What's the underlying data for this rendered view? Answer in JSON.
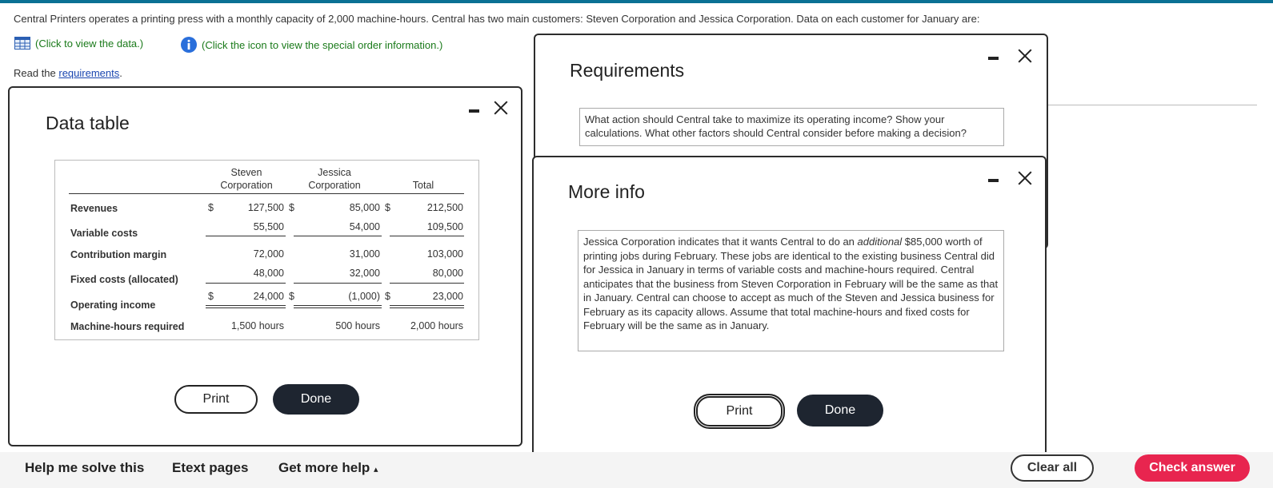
{
  "intro_text": "Central Printers operates a printing press with a monthly capacity of 2,000 machine-hours. Central has two main customers: Steven Corporation and Jessica Corporation. Data on each customer for January are:",
  "view_data_link": "(Click to view the data.)",
  "view_info_link": "(Click the icon to view the special order information.)",
  "read_prefix": "Read the ",
  "requirements_link": "requirements",
  "read_suffix": ".",
  "data_dialog": {
    "title": "Data table",
    "table": {
      "headers": {
        "steven": "Steven\nCorporation",
        "jessica": "Jessica\nCorporation",
        "total": "Total"
      },
      "rows": {
        "revenues": {
          "label": "Revenues",
          "steven": "127,500",
          "jessica": "85,000",
          "total": "212,500"
        },
        "variable_costs": {
          "label": "Variable costs",
          "steven": "55,500",
          "jessica": "54,000",
          "total": "109,500"
        },
        "contribution_margin": {
          "label": "Contribution margin",
          "steven": "72,000",
          "jessica": "31,000",
          "total": "103,000"
        },
        "fixed_costs": {
          "label": "Fixed costs (allocated)",
          "steven": "48,000",
          "jessica": "32,000",
          "total": "80,000"
        },
        "operating_income": {
          "label": "Operating income",
          "steven": "24,000",
          "jessica": "(1,000)",
          "total": "23,000"
        },
        "machine_hours": {
          "label": "Machine-hours required",
          "steven": "1,500 hours",
          "jessica": "500 hours",
          "total": "2,000 hours"
        }
      },
      "currency_symbol": "$"
    },
    "print_label": "Print",
    "done_label": "Done"
  },
  "requirements_dialog": {
    "title": "Requirements",
    "text": "What action should Central take to maximize its operating income? Show your calculations. What other factors should Central consider before making a decision?"
  },
  "more_info_dialog": {
    "title": "More info",
    "text_before": "Jessica Corporation indicates that it wants Central to do an ",
    "text_emphasis": "additional",
    "text_after": " $85,000 worth of printing jobs during February. These jobs are identical to the existing business Central did for Jessica in January in terms of variable costs and machine-hours required. Central anticipates that the business from Steven Corporation in February will be the same as that in January. Central can choose to accept as much of the Steven and Jessica business for February as its capacity allows. Assume that total machine-hours and fixed costs for February will be the same as in January.",
    "print_label": "Print",
    "done_label": "Done"
  },
  "footer": {
    "help_label": "Help me solve this",
    "etext_label": "Etext pages",
    "more_help_label": "Get more help",
    "more_help_arrow": "▴",
    "clear_label": "Clear all",
    "check_label": "Check answer"
  },
  "colors": {
    "accent_bar": "#0a7194",
    "link_green": "#1a7a1a",
    "check_button": "#e8254f",
    "done_button": "#1e2530"
  }
}
